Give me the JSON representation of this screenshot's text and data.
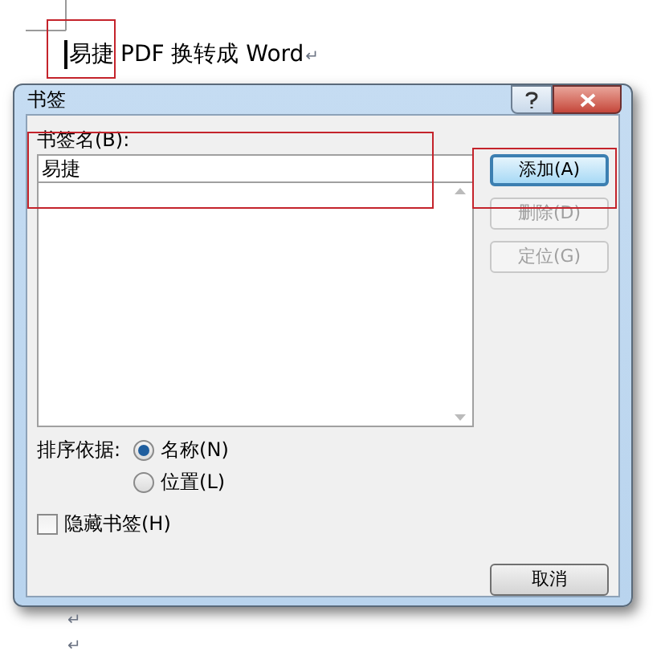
{
  "document": {
    "selected_text": "易捷",
    "rest_text": "PDF 换转成 Word",
    "paragraph_mark": "↵",
    "trailing_marks": [
      "↵",
      "↵"
    ]
  },
  "dialog": {
    "title": "书签",
    "name_label": "书签名(B):",
    "name_value": "易捷",
    "buttons": [
      {
        "label": "添加(A)",
        "disabled": false,
        "default": true
      },
      {
        "label": "删除(D)",
        "disabled": true,
        "default": false
      },
      {
        "label": "定位(G)",
        "disabled": true,
        "default": false
      }
    ],
    "sort": {
      "label": "排序依据:",
      "options": [
        {
          "label": "名称(N)",
          "selected": true
        },
        {
          "label": "位置(L)",
          "selected": false
        }
      ]
    },
    "hide_checkbox": {
      "label": "隐藏书签(H)",
      "checked": false
    },
    "cancel": "取消"
  }
}
